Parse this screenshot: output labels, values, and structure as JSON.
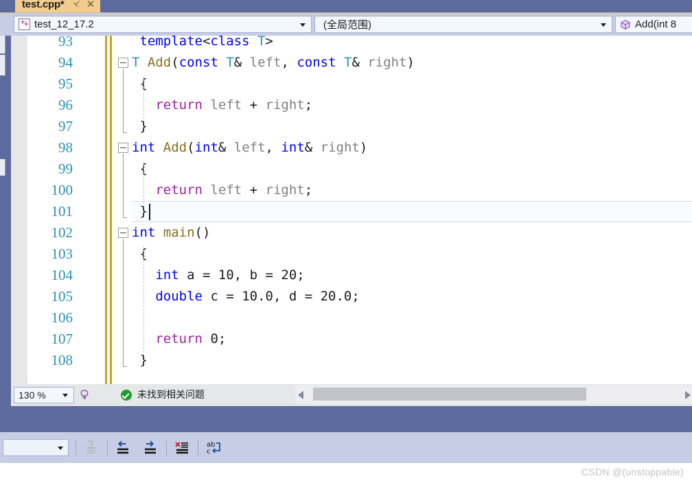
{
  "window": {
    "tab": {
      "title": "test.cpp*",
      "pin_icon": "pin-icon",
      "close_icon": "close-icon"
    }
  },
  "navbar": {
    "project_combo": {
      "icon": "cpp-project-icon",
      "value": "test_12_17.2",
      "arrow_icon": "chevron-down-icon"
    },
    "scope_combo": {
      "value": "(全局范围)",
      "arrow_icon": "chevron-down-icon"
    },
    "member_combo": {
      "icon": "method-cube-icon",
      "value": "Add(int 8"
    }
  },
  "editor": {
    "lines": [
      {
        "num": "93",
        "indent": 1,
        "fold": null,
        "tokens": [
          {
            "t": "template",
            "c": "kw"
          },
          {
            "t": "<",
            "c": "op"
          },
          {
            "t": "class",
            "c": "kw"
          },
          {
            "t": " ",
            "c": "plain"
          },
          {
            "t": "T",
            "c": "type"
          },
          {
            "t": ">",
            "c": "op"
          }
        ]
      },
      {
        "num": "94",
        "indent": 0,
        "fold": "minus",
        "tokens": [
          {
            "t": "T",
            "c": "type"
          },
          {
            "t": " ",
            "c": "plain"
          },
          {
            "t": "Add",
            "c": "fn"
          },
          {
            "t": "(",
            "c": "op"
          },
          {
            "t": "const",
            "c": "kw"
          },
          {
            "t": " ",
            "c": "plain"
          },
          {
            "t": "T",
            "c": "type"
          },
          {
            "t": "& ",
            "c": "op"
          },
          {
            "t": "left",
            "c": "id"
          },
          {
            "t": ", ",
            "c": "op"
          },
          {
            "t": "const",
            "c": "kw"
          },
          {
            "t": " ",
            "c": "plain"
          },
          {
            "t": "T",
            "c": "type"
          },
          {
            "t": "& ",
            "c": "op"
          },
          {
            "t": "right",
            "c": "id"
          },
          {
            "t": ")",
            "c": "op"
          }
        ]
      },
      {
        "num": "95",
        "indent": 1,
        "fold": null,
        "tokens": [
          {
            "t": "{",
            "c": "op"
          }
        ]
      },
      {
        "num": "96",
        "indent": 3,
        "fold": null,
        "tokens": [
          {
            "t": "return",
            "c": "ctl"
          },
          {
            "t": " ",
            "c": "plain"
          },
          {
            "t": "left",
            "c": "id"
          },
          {
            "t": " + ",
            "c": "op"
          },
          {
            "t": "right",
            "c": "id"
          },
          {
            "t": ";",
            "c": "op"
          }
        ]
      },
      {
        "num": "97",
        "indent": 1,
        "fold": null,
        "tokens": [
          {
            "t": "}",
            "c": "op"
          }
        ]
      },
      {
        "num": "98",
        "indent": 0,
        "fold": "minus",
        "tokens": [
          {
            "t": "int",
            "c": "kw"
          },
          {
            "t": " ",
            "c": "plain"
          },
          {
            "t": "Add",
            "c": "fn"
          },
          {
            "t": "(",
            "c": "op"
          },
          {
            "t": "int",
            "c": "kw"
          },
          {
            "t": "& ",
            "c": "op"
          },
          {
            "t": "left",
            "c": "id"
          },
          {
            "t": ", ",
            "c": "op"
          },
          {
            "t": "int",
            "c": "kw"
          },
          {
            "t": "& ",
            "c": "op"
          },
          {
            "t": "right",
            "c": "id"
          },
          {
            "t": ")",
            "c": "op"
          }
        ]
      },
      {
        "num": "99",
        "indent": 1,
        "fold": null,
        "tokens": [
          {
            "t": "{",
            "c": "op"
          }
        ]
      },
      {
        "num": "100",
        "indent": 3,
        "fold": null,
        "tokens": [
          {
            "t": "return",
            "c": "ctl"
          },
          {
            "t": " ",
            "c": "plain"
          },
          {
            "t": "left",
            "c": "id"
          },
          {
            "t": " + ",
            "c": "op"
          },
          {
            "t": "right",
            "c": "id"
          },
          {
            "t": ";",
            "c": "op"
          }
        ]
      },
      {
        "num": "101",
        "indent": 1,
        "fold": null,
        "current": true,
        "tokens": [
          {
            "t": "}",
            "c": "op"
          }
        ]
      },
      {
        "num": "102",
        "indent": 0,
        "fold": "minus",
        "tokens": [
          {
            "t": "int",
            "c": "kw"
          },
          {
            "t": " ",
            "c": "plain"
          },
          {
            "t": "main",
            "c": "fn"
          },
          {
            "t": "()",
            "c": "op"
          }
        ]
      },
      {
        "num": "103",
        "indent": 1,
        "fold": null,
        "tokens": [
          {
            "t": "{",
            "c": "op"
          }
        ]
      },
      {
        "num": "104",
        "indent": 3,
        "fold": null,
        "tokens": [
          {
            "t": "int",
            "c": "kw"
          },
          {
            "t": " ",
            "c": "plain"
          },
          {
            "t": "a = 10, b = 20;",
            "c": "plain"
          }
        ]
      },
      {
        "num": "105",
        "indent": 3,
        "fold": null,
        "tokens": [
          {
            "t": "double",
            "c": "kw"
          },
          {
            "t": " ",
            "c": "plain"
          },
          {
            "t": "c = 10.0, d = 20.0;",
            "c": "plain"
          }
        ]
      },
      {
        "num": "106",
        "indent": 3,
        "fold": null,
        "tokens": []
      },
      {
        "num": "107",
        "indent": 3,
        "fold": null,
        "tokens": [
          {
            "t": "return",
            "c": "ctl"
          },
          {
            "t": " ",
            "c": "plain"
          },
          {
            "t": "0",
            "c": "plain"
          },
          {
            "t": ";",
            "c": "op"
          }
        ]
      },
      {
        "num": "108",
        "indent": 1,
        "fold": null,
        "tokens": [
          {
            "t": "}",
            "c": "op"
          }
        ]
      }
    ]
  },
  "statusbar": {
    "zoom": {
      "value": "130 %",
      "arrow_icon": "chevron-down-icon"
    },
    "lightbulb_icon": "lightbulb-icon",
    "status_icon": "success-check-icon",
    "status_message": "未找到相关问题",
    "scrollbar": {
      "left_arrow_icon": "arrow-left-icon",
      "right_arrow_icon": "arrow-right-icon"
    }
  },
  "bottom_toolbar": {
    "combo": {
      "value": "",
      "arrow_icon": "chevron-down-icon"
    },
    "buttons": [
      {
        "name": "stamp-icon",
        "disabled": true
      },
      {
        "name": "indent-left-icon",
        "disabled": false
      },
      {
        "name": "indent-right-icon",
        "disabled": false
      },
      {
        "name": "clear-all-icon",
        "disabled": false
      },
      {
        "name": "word-wrap-icon",
        "disabled": false
      }
    ]
  },
  "watermark": {
    "text": "CSDN @(unstoppable)"
  },
  "colors": {
    "chrome_blue": "#5c6a9e",
    "toolbar_blue": "#c6cde4",
    "tab_active": "#f2cd8f",
    "linenum": "#2b91af",
    "keyword": "#0000ff",
    "type": "#2b91af",
    "function": "#8a6d1f",
    "control": "#a020a0",
    "identifier": "#808080",
    "changebar": "#c9a227",
    "status_ok": "#1f9c32"
  }
}
